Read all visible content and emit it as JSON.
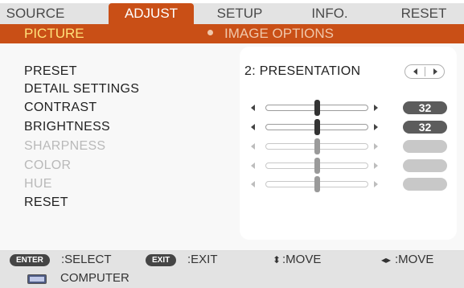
{
  "tabs": [
    {
      "label": "SOURCE",
      "active": false
    },
    {
      "label": "ADJUST",
      "active": true
    },
    {
      "label": "SETUP",
      "active": false
    },
    {
      "label": "INFO.",
      "active": false
    },
    {
      "label": "RESET",
      "active": false
    }
  ],
  "subtabs": {
    "active": "PICTURE",
    "other": "IMAGE OPTIONS"
  },
  "menu": {
    "preset": {
      "label": "PRESET",
      "value": "2:  PRESENTATION"
    },
    "detail_settings": {
      "label": "DETAIL SETTINGS"
    },
    "contrast": {
      "label": "CONTRAST",
      "value": "32",
      "level_fraction": 0.5,
      "enabled": true
    },
    "brightness": {
      "label": "BRIGHTNESS",
      "value": "32",
      "level_fraction": 0.5,
      "enabled": true
    },
    "sharpness": {
      "label": "SHARPNESS",
      "value": "",
      "level_fraction": 0.5,
      "enabled": false
    },
    "color": {
      "label": "COLOR",
      "value": "",
      "level_fraction": 0.5,
      "enabled": false
    },
    "hue": {
      "label": "HUE",
      "value": "",
      "level_fraction": 0.5,
      "enabled": false
    },
    "reset": {
      "label": "RESET"
    }
  },
  "footer": {
    "enter_key": "ENTER",
    "select_label": ":SELECT",
    "exit_key": "EXIT",
    "exit_label": ":EXIT",
    "updown_glyph": "⬍",
    "move_label_1": ":MOVE",
    "leftright_glyph": "◂▸",
    "move_label_2": ":MOVE"
  },
  "status": {
    "source": "COMPUTER",
    "icon": "monitor-icon"
  },
  "colors": {
    "accent": "#c94f16",
    "active_subtab_text": "#ffe07a",
    "disabled_text": "#b9b9b9"
  }
}
